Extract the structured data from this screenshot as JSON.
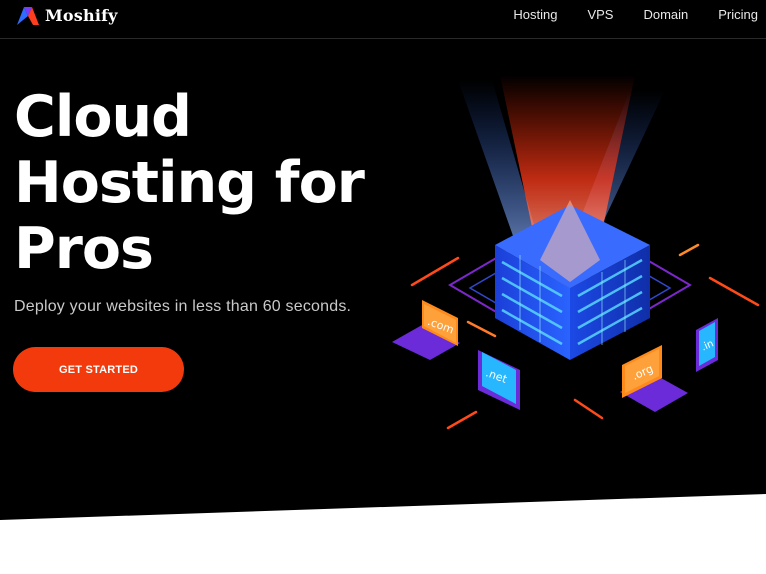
{
  "brand": {
    "name": "Moshify",
    "icon": "moshify-logo-icon"
  },
  "nav": {
    "items": [
      {
        "label": "Hosting"
      },
      {
        "label": "VPS"
      },
      {
        "label": "Domain"
      },
      {
        "label": "Pricing"
      }
    ]
  },
  "hero": {
    "headline_lines": [
      "Cloud",
      "Hosting for",
      "Pros"
    ],
    "subtitle": "Deploy your websites in less than 60 seconds.",
    "cta_label": "GET STARTED"
  },
  "illustration": {
    "icon": "cloud-server-illustration",
    "device_labels": [
      ".com",
      ".net",
      ".org",
      ".in"
    ]
  },
  "colors": {
    "background": "#000000",
    "accent": "#f23a0c",
    "server_blue": "#1f5cff",
    "glow_purple": "#7a3cff"
  }
}
